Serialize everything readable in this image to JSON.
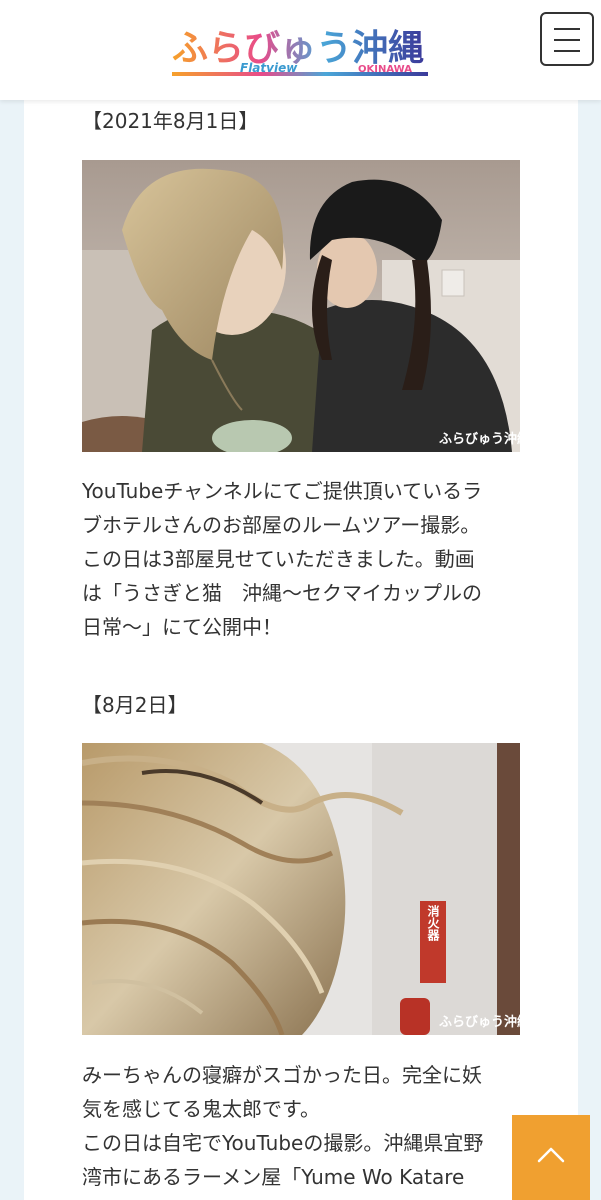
{
  "header": {
    "logo_main": "ふらびゅう沖縄",
    "logo_sub_left": "Flatview",
    "logo_sub_right": "OKINAWA",
    "menu_icon": "hamburger-icon"
  },
  "article": {
    "sections": [
      {
        "date": "【2021年8月1日】",
        "watermark": "ふらびゅう沖縄",
        "paragraph_lines": [
          "YouTubeチャンネルにてご提供頂いているラ",
          "ブホテルさんのお部屋のルームツアー撮影。",
          "この日は3部屋見せていただきました。動画",
          "は「うさぎと猫　沖縄〜セクマイカップルの",
          "日常〜」にて公開中！"
        ]
      },
      {
        "date": "【8月2日】",
        "watermark": "ふらびゅう沖縄",
        "sign_text": "消火器",
        "paragraph_lines": [
          "みーちゃんの寝癖がスゴかった日。完全に妖",
          "気を感じてる鬼太郎です。",
          "この日は自宅でYouTubeの撮影。沖縄県宜野",
          "湾市にあるラーメン屋「Yume Wo Katare"
        ]
      }
    ]
  },
  "scroll_top": {
    "icon": "chevron-up-icon"
  },
  "colors": {
    "accent_orange": "#f0a030",
    "page_bg": "#eaf3f8"
  }
}
